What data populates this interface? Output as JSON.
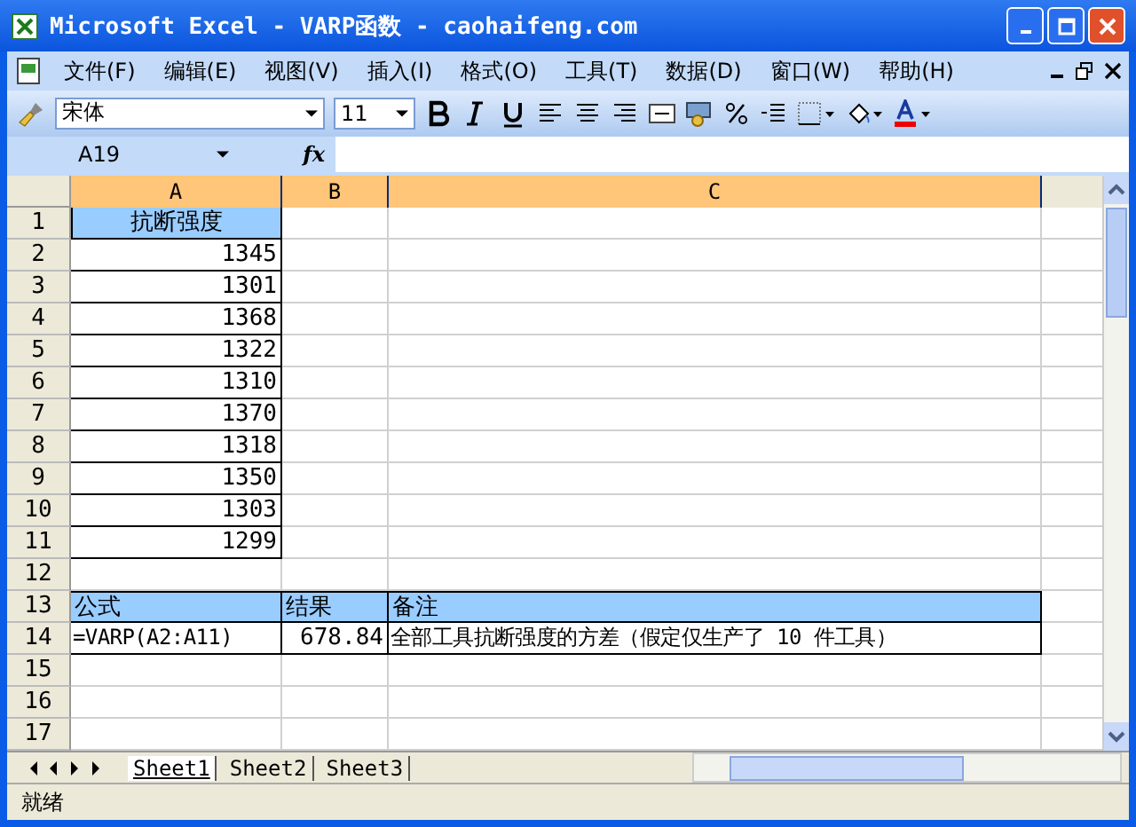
{
  "window": {
    "title": "Microsoft Excel - VARP函数 - caohaifeng.com"
  },
  "menu": [
    "文件(F)",
    "编辑(E)",
    "视图(V)",
    "插入(I)",
    "格式(O)",
    "工具(T)",
    "数据(D)",
    "窗口(W)",
    "帮助(H)"
  ],
  "toolbar": {
    "font": "宋体",
    "size": "11"
  },
  "formula_bar": {
    "name_box": "A19",
    "fx": "fx"
  },
  "columns": [
    {
      "label": "A",
      "selected": true
    },
    {
      "label": "B",
      "selected": true
    },
    {
      "label": "C",
      "selected": true
    }
  ],
  "rows": [
    {
      "label": "1",
      "cells": [
        {
          "kind": "title",
          "text": "抗断强度"
        },
        {
          "kind": "blank"
        },
        {
          "kind": "blank"
        }
      ]
    },
    {
      "label": "2",
      "cells": [
        {
          "kind": "number",
          "text": "1345"
        },
        {
          "kind": "blank"
        },
        {
          "kind": "blank"
        }
      ]
    },
    {
      "label": "3",
      "cells": [
        {
          "kind": "number",
          "text": "1301"
        },
        {
          "kind": "blank"
        },
        {
          "kind": "blank"
        }
      ]
    },
    {
      "label": "4",
      "cells": [
        {
          "kind": "number",
          "text": "1368"
        },
        {
          "kind": "blank"
        },
        {
          "kind": "blank"
        }
      ]
    },
    {
      "label": "5",
      "cells": [
        {
          "kind": "number",
          "text": "1322"
        },
        {
          "kind": "blank"
        },
        {
          "kind": "blank"
        }
      ]
    },
    {
      "label": "6",
      "cells": [
        {
          "kind": "number",
          "text": "1310"
        },
        {
          "kind": "blank"
        },
        {
          "kind": "blank"
        }
      ]
    },
    {
      "label": "7",
      "cells": [
        {
          "kind": "number",
          "text": "1370"
        },
        {
          "kind": "blank"
        },
        {
          "kind": "blank"
        }
      ]
    },
    {
      "label": "8",
      "cells": [
        {
          "kind": "number",
          "text": "1318"
        },
        {
          "kind": "blank"
        },
        {
          "kind": "blank"
        }
      ]
    },
    {
      "label": "9",
      "cells": [
        {
          "kind": "number",
          "text": "1350"
        },
        {
          "kind": "blank"
        },
        {
          "kind": "blank"
        }
      ]
    },
    {
      "label": "10",
      "cells": [
        {
          "kind": "number",
          "text": "1303"
        },
        {
          "kind": "blank"
        },
        {
          "kind": "blank"
        }
      ]
    },
    {
      "label": "11",
      "cells": [
        {
          "kind": "number",
          "text": "1299"
        },
        {
          "kind": "blank"
        },
        {
          "kind": "blank"
        }
      ]
    },
    {
      "label": "12",
      "cells": [
        {
          "kind": "blank"
        },
        {
          "kind": "blank"
        },
        {
          "kind": "blank"
        }
      ]
    },
    {
      "label": "13",
      "cells": [
        {
          "kind": "label",
          "text": "公式"
        },
        {
          "kind": "label",
          "text": "结果"
        },
        {
          "kind": "label",
          "text": "备注"
        }
      ]
    },
    {
      "label": "14",
      "cells": [
        {
          "kind": "text",
          "text": "=VARP(A2:A11)"
        },
        {
          "kind": "number",
          "text": "678.84"
        },
        {
          "kind": "text",
          "text": "全部工具抗断强度的方差（假定仅生产了 10 件工具）"
        }
      ]
    },
    {
      "label": "15",
      "cells": [
        {
          "kind": "blank"
        },
        {
          "kind": "blank"
        },
        {
          "kind": "blank"
        }
      ]
    },
    {
      "label": "16",
      "cells": [
        {
          "kind": "blank"
        },
        {
          "kind": "blank"
        },
        {
          "kind": "blank"
        }
      ]
    },
    {
      "label": "17",
      "cells": [
        {
          "kind": "blank"
        },
        {
          "kind": "blank"
        },
        {
          "kind": "blank"
        }
      ]
    }
  ],
  "sheet_tabs": [
    {
      "label": "Sheet1",
      "selected": true
    },
    {
      "label": "Sheet2",
      "selected": false
    },
    {
      "label": "Sheet3",
      "selected": false
    }
  ],
  "status_bar": {
    "text": "就绪"
  }
}
